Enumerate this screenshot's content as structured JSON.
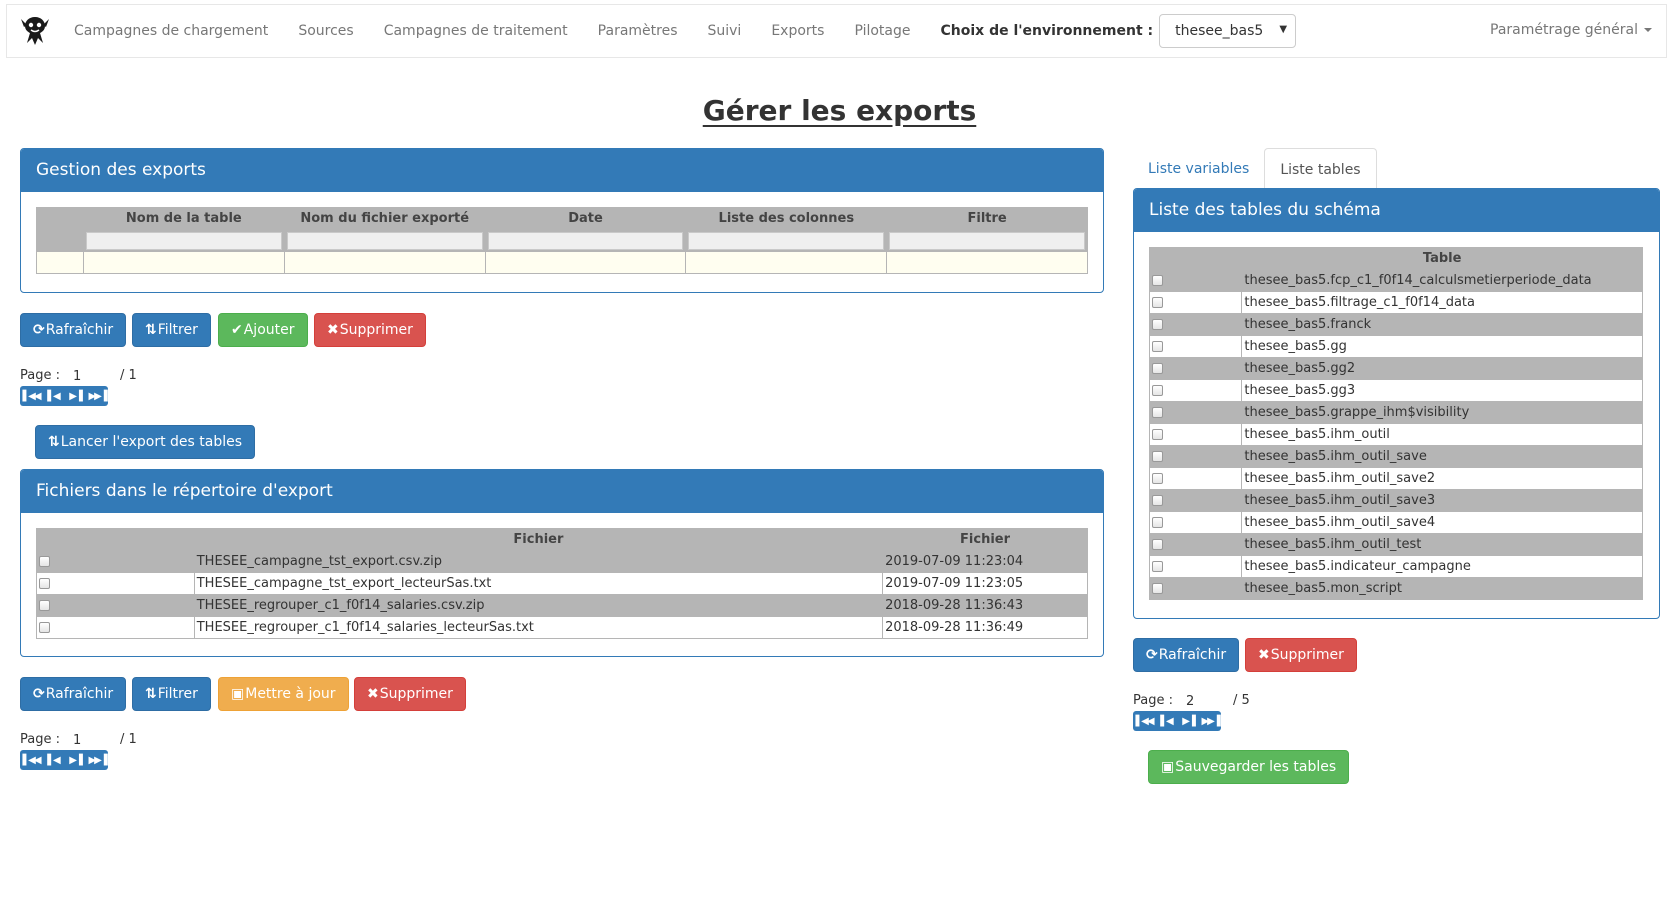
{
  "nav": {
    "items": [
      "Campagnes de chargement",
      "Sources",
      "Campagnes de traitement",
      "Paramètres",
      "Suivi",
      "Exports",
      "Pilotage"
    ],
    "env_label": "Choix de l'environnement :",
    "env_value": "thesee_bas5",
    "right_menu": "Paramétrage général"
  },
  "title": "Gérer les exports",
  "exports_panel": {
    "heading": "Gestion des exports",
    "columns": [
      "Nom de la table",
      "Nom du fichier exporté",
      "Date",
      "Liste des colonnes",
      "Filtre"
    ],
    "buttons": {
      "refresh": "Rafraîchir",
      "filter": "Filtrer",
      "add": "Ajouter",
      "delete": "Supprimer"
    },
    "pager": {
      "label": "Page :",
      "page": "1",
      "total": "/ 1"
    }
  },
  "launch_button": "Lancer l'export des tables",
  "files_panel": {
    "heading": "Fichiers dans le répertoire d'export",
    "columns": [
      "Fichier",
      "Fichier"
    ],
    "rows": [
      {
        "name": "THESEE_campagne_tst_export.csv.zip",
        "date": "2019-07-09 11:23:04"
      },
      {
        "name": "THESEE_campagne_tst_export_lecteurSas.txt",
        "date": "2019-07-09 11:23:05"
      },
      {
        "name": "THESEE_regrouper_c1_f0f14_salaries.csv.zip",
        "date": "2018-09-28 11:36:43"
      },
      {
        "name": "THESEE_regrouper_c1_f0f14_salaries_lecteurSas.txt",
        "date": "2018-09-28 11:36:49"
      }
    ],
    "buttons": {
      "refresh": "Rafraîchir",
      "filter": "Filtrer",
      "update": "Mettre à jour",
      "delete": "Supprimer"
    },
    "pager": {
      "label": "Page :",
      "page": "1",
      "total": "/ 1"
    }
  },
  "tabs": [
    "Liste variables",
    "Liste tables"
  ],
  "tables_panel": {
    "heading": "Liste des tables du schéma",
    "column": "Table",
    "rows": [
      "thesee_bas5.fcp_c1_f0f14_calculsmetierperiode_data",
      "thesee_bas5.filtrage_c1_f0f14_data",
      "thesee_bas5.franck",
      "thesee_bas5.gg",
      "thesee_bas5.gg2",
      "thesee_bas5.gg3",
      "thesee_bas5.grappe_ihm$visibility",
      "thesee_bas5.ihm_outil",
      "thesee_bas5.ihm_outil_save",
      "thesee_bas5.ihm_outil_save2",
      "thesee_bas5.ihm_outil_save3",
      "thesee_bas5.ihm_outil_save4",
      "thesee_bas5.ihm_outil_test",
      "thesee_bas5.indicateur_campagne",
      "thesee_bas5.mon_script"
    ],
    "buttons": {
      "refresh": "Rafraîchir",
      "delete": "Supprimer"
    },
    "pager": {
      "label": "Page :",
      "page": "2",
      "total": "/ 5"
    },
    "save_button": "Sauvegarder les tables"
  },
  "icons": {
    "refresh": "refresh-icon",
    "filter": "sort-icon",
    "add": "check-icon",
    "delete": "remove-icon",
    "update": "floppy-icon",
    "save": "floppy-icon",
    "launch": "sort-icon"
  },
  "colors": {
    "primary": "#337ab7",
    "success": "#5cb85c",
    "danger": "#d9534f",
    "warning": "#f0ad4e",
    "grid": "#b5b5b5"
  }
}
